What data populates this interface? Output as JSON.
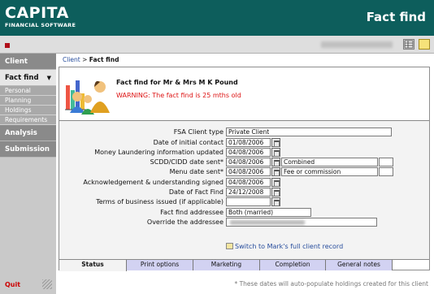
{
  "app": {
    "logo_name": "CAPITA",
    "logo_sub": "FINANCIAL SOFTWARE",
    "page_title": "Fact find"
  },
  "sidebar": {
    "sections": [
      {
        "label": "Client"
      },
      {
        "label": "Fact find"
      },
      {
        "label": "Analysis"
      },
      {
        "label": "Submission"
      }
    ],
    "subitems": [
      {
        "label": "Personal"
      },
      {
        "label": "Planning"
      },
      {
        "label": "Holdings"
      },
      {
        "label": "Requirements"
      }
    ],
    "quit_label": "Quit"
  },
  "breadcrumb": {
    "link": "Client",
    "sep": " > ",
    "current": "Fact find"
  },
  "fact_find": {
    "title": "Fact find for Mr  &  Mrs M K Pound",
    "warning": "WARNING: The fact find is 25 mths old"
  },
  "form": {
    "fsa_client_type": {
      "label": "FSA Client type",
      "value": "Private Client"
    },
    "date_initial_contact": {
      "label": "Date of initial contact",
      "value": "01/08/2006"
    },
    "money_laundering": {
      "label": "Money Laundering information updated",
      "value": "04/08/2006"
    },
    "scdd_cidd": {
      "label": "SCDD/CIDD date sent*",
      "value": "04/08/2006",
      "extra": "Combined"
    },
    "menu_date": {
      "label": "Menu date sent*",
      "value": "04/08/2006",
      "extra": "Fee or commission"
    },
    "ack_signed": {
      "label": "Acknowledgement & understanding signed",
      "value": "04/08/2006"
    },
    "date_fact_find": {
      "label": "Date of Fact Find",
      "value": "24/12/2008"
    },
    "terms_issued": {
      "label": "Terms of business issued (if applicable)",
      "value": ""
    },
    "addressee": {
      "label": "Fact find addressee",
      "value": "Both (married)"
    },
    "override": {
      "label": "Override the addressee",
      "value": ""
    }
  },
  "switch_link": "Switch to Mark's full client record",
  "tabs": [
    {
      "label": "Status"
    },
    {
      "label": "Print options"
    },
    {
      "label": "Marketing"
    },
    {
      "label": "Completion"
    },
    {
      "label": "General notes"
    }
  ],
  "footer_note": "* These dates will auto-populate holdings created for this client",
  "colors": {
    "brand": "#0d5e5c",
    "warning": "#dd1111",
    "tab_bg": "#d2d2f2"
  },
  "icons": [
    "family-icon",
    "calendar-icon",
    "grid-icon",
    "note-icon",
    "switch-client-icon"
  ]
}
